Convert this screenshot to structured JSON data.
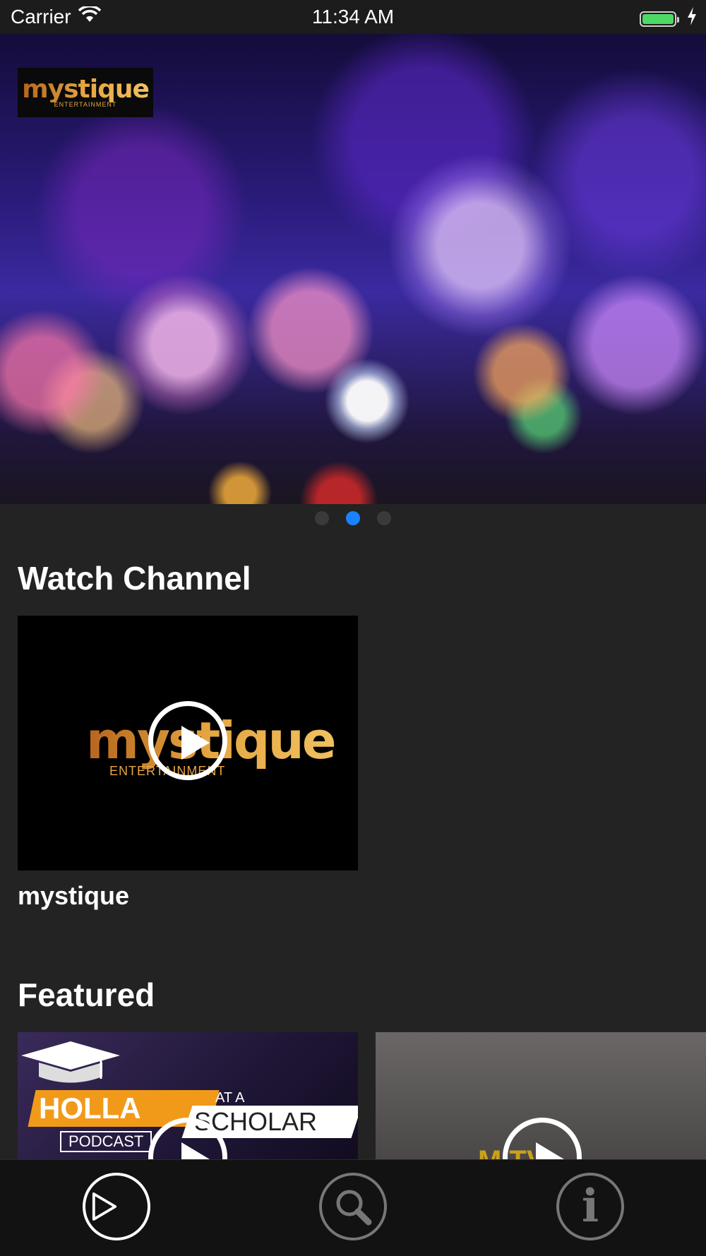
{
  "status_bar": {
    "carrier": "Carrier",
    "time": "11:34 AM",
    "wifi_icon": "wifi-icon",
    "battery_icon": "battery-icon",
    "charging_icon": "charging-bolt-icon"
  },
  "hero": {
    "logo_text": "mystique",
    "logo_subtext": "ENTERTAINMENT",
    "pages": 3,
    "active_page": 2
  },
  "watch_channel": {
    "title": "Watch Channel",
    "items": [
      {
        "label": "mystique",
        "logo_text": "mystique",
        "logo_subtext": "ENTERTAINMENT"
      }
    ]
  },
  "featured": {
    "title": "Featured",
    "items": [
      {
        "title_line1": "HOLLA",
        "title_line2": "AT A",
        "title_line3": "SCHOLAR",
        "subtitle": "PODCAST"
      },
      {
        "title_line1": "M TV"
      }
    ]
  },
  "tab_bar": {
    "tabs": [
      {
        "name": "play",
        "icon": "play-icon",
        "active": true
      },
      {
        "name": "search",
        "icon": "search-icon",
        "active": false
      },
      {
        "name": "info",
        "icon": "info-icon",
        "active": false
      }
    ],
    "info_glyph": "i"
  },
  "colors": {
    "background": "#232323",
    "accent": "#1a82ff",
    "battery": "#4cd964",
    "logo_gold": "#e6a640"
  }
}
